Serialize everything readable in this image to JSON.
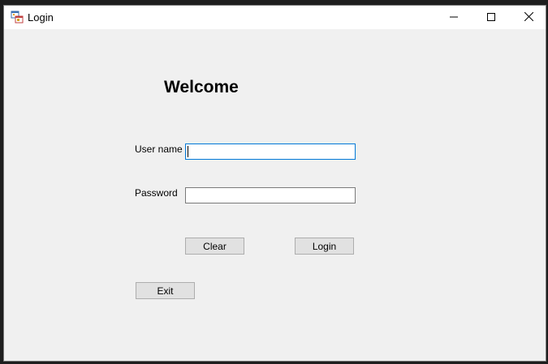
{
  "window": {
    "title": "Login",
    "app_icon": "windows-form-icon",
    "controls": {
      "minimize_icon": "minimize-icon",
      "maximize_icon": "maximize-icon",
      "close_icon": "close-icon"
    }
  },
  "form": {
    "heading": "Welcome",
    "username_label": "User name",
    "username_value": "",
    "password_label": "Password",
    "password_value": "",
    "clear_label": "Clear",
    "login_label": "Login",
    "exit_label": "Exit"
  },
  "colors": {
    "form_background": "#f0f0f0",
    "focus_border": "#0078d7",
    "button_background": "#e1e1e1"
  }
}
